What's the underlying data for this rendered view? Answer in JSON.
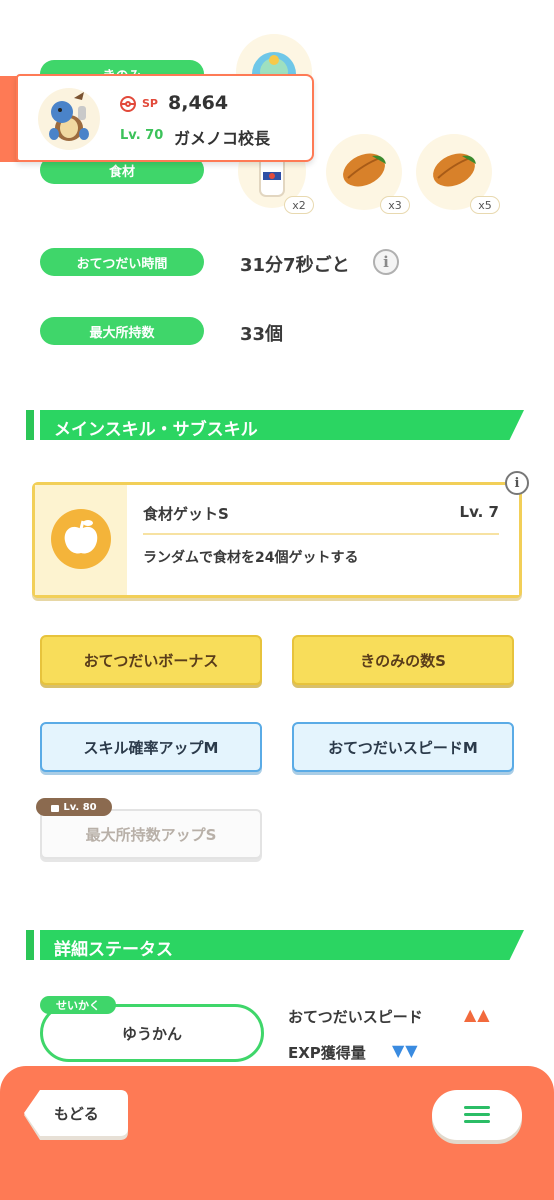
{
  "pokemon_card": {
    "sp_label": "SP",
    "sp_value": "8,464",
    "level": "Lv. 70",
    "name": "ガメノコ校長"
  },
  "info_rows": {
    "berry_label": "きのみ",
    "ingredient_label": "食材",
    "help_time_label": "おてつだい時間",
    "help_time_value": "31分7秒ごと",
    "max_carry_label": "最大所持数",
    "max_carry_value": "33個"
  },
  "ingredients": [
    {
      "icon": "milk-bottle-icon",
      "count": "x2"
    },
    {
      "icon": "cacao-icon",
      "count": "x3"
    },
    {
      "icon": "cacao-icon",
      "count": "x5"
    }
  ],
  "skills_section": {
    "title": "メインスキル・サブスキル",
    "main_skill": {
      "name": "食材ゲットS",
      "level": "Lv. 7",
      "description": "ランダムで食材を24個ゲットする",
      "icon": "apple-icon"
    },
    "sub_skills": [
      {
        "label": "おてつだいボーナス",
        "style": "yellow"
      },
      {
        "label": "きのみの数S",
        "style": "yellow"
      },
      {
        "label": "スキル確率アップM",
        "style": "blue"
      },
      {
        "label": "おてつだいスピードM",
        "style": "blue"
      },
      {
        "label": "最大所持数アップS",
        "style": "locked",
        "lock_level": "Lv. 80"
      }
    ]
  },
  "details_section": {
    "title": "詳細ステータス",
    "nature_tag": "せいかく",
    "nature_value": "ゆうかん",
    "stat_up_label": "おてつだいスピード",
    "stat_up_marks": "▲▲",
    "stat_down_label": "EXP獲得量",
    "stat_down_marks": "▼▼"
  },
  "footer": {
    "back_label": "もどる",
    "menu_icon": "hamburger-menu-icon"
  },
  "colors": {
    "green": "#3fd66a",
    "orange": "#fe7a55",
    "yellow": "#f8dd5a",
    "blue_border": "#5aabe6"
  }
}
